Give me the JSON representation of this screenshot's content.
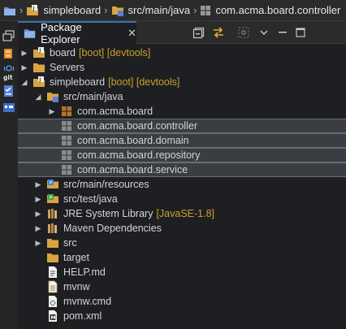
{
  "breadcrumb": {
    "project": "simpleboard",
    "source_folder": "src/main/java",
    "package": "com.acma.board.controller",
    "separator": "›"
  },
  "view": {
    "tab_title": "Package Explorer",
    "tab_close": "✕"
  },
  "tree": [
    {
      "label": "board",
      "decor": "[boot] [devtools]",
      "expand": "collapsed"
    },
    {
      "label": "Servers",
      "decor": "",
      "expand": "collapsed"
    },
    {
      "label": "simpleboard",
      "decor": "[boot] [devtools]",
      "expand": "expanded"
    },
    {
      "label": "src/main/java",
      "decor": "",
      "expand": "expanded"
    },
    {
      "label": "com.acma.board",
      "decor": "",
      "expand": "collapsed"
    },
    {
      "label": "com.acma.board.controller",
      "decor": "",
      "expand": "none",
      "selected": true
    },
    {
      "label": "com.acma.board.domain",
      "decor": "",
      "expand": "none",
      "selected": true
    },
    {
      "label": "com.acma.board.repository",
      "decor": "",
      "expand": "none",
      "selected": true
    },
    {
      "label": "com.acma.board.service",
      "decor": "",
      "expand": "none",
      "selected": true
    },
    {
      "label": "src/main/resources",
      "decor": "",
      "expand": "collapsed"
    },
    {
      "label": "src/test/java",
      "decor": "",
      "expand": "collapsed"
    },
    {
      "label": "JRE System Library",
      "decor": "[JavaSE-1.8]",
      "expand": "collapsed"
    },
    {
      "label": "Maven Dependencies",
      "decor": "",
      "expand": "collapsed"
    },
    {
      "label": "src",
      "decor": "",
      "expand": "collapsed"
    },
    {
      "label": "target",
      "decor": "",
      "expand": "none"
    },
    {
      "label": "HELP.md",
      "decor": "",
      "expand": "none"
    },
    {
      "label": "mvnw",
      "decor": "",
      "expand": "none"
    },
    {
      "label": "mvnw.cmd",
      "decor": "",
      "expand": "none"
    },
    {
      "label": "pom.xml",
      "decor": "",
      "expand": "none"
    }
  ],
  "colors": {
    "selection": "#3a3d41",
    "decoration": "#c9a227",
    "package": "#b8732a",
    "empty_package": "#8a8a8a",
    "folder": "#d9a441"
  }
}
